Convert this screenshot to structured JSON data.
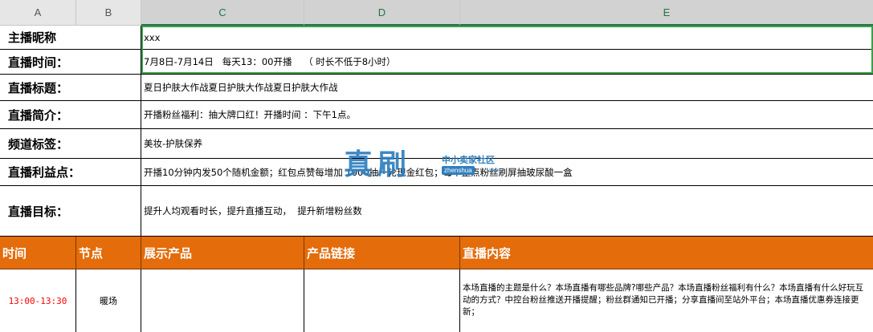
{
  "column_headers": [
    "A",
    "B",
    "C",
    "D",
    "E"
  ],
  "info_rows": [
    {
      "label": "主播昵称",
      "value": "xxx"
    },
    {
      "label": "直播时间：",
      "value": "7月8日-7月14日   每天13：00开播    （ 时长不低于8小时）"
    },
    {
      "label": "直播标题：",
      "value": "夏日护肤大作战夏日护肤大作战夏日护肤大作战"
    },
    {
      "label": "直播简介：",
      "value": "开播粉丝福利：抽大牌口红！开播时间 ：下午1点。"
    },
    {
      "label": "频道标签：",
      "value": "美妆-护肤保养"
    },
    {
      "label": "直播利益点：",
      "value": "开播10分钟内发50个随机金额；红包点赞每增加 1000抽一轮现金红包；每个整点粉丝刷屏抽玻尿酸一盒"
    },
    {
      "label": "直播目标：",
      "value": "提升人均观看时长，提升直播互动，  提升新增粉丝数"
    }
  ],
  "table_header": [
    "时间",
    "节点",
    "展示产品",
    "产品链接",
    "直播内容"
  ],
  "table_rows": [
    {
      "time": "13:00-13:30",
      "node": "暖场",
      "product": "",
      "link": "",
      "content": "本场直播的主题是什么？本场直播有哪些品牌?哪些产品？本场直播粉丝福利有什么？本场直播有什么好玩互动的方式？中控台粉丝推送开播提醒；粉丝群通知已开播；分享直播间至站外平台；本场直播优惠券连接更新；"
    }
  ],
  "watermark": {
    "big": "真刷",
    "small": "中小卖家社区",
    "domain": "zhenshua",
    "suffix": ".com"
  },
  "colors": {
    "header_orange": "#e46c0a",
    "selection_green": "#3aa04a",
    "time_red": "#ff0000",
    "watermark_blue": "#2f7fbf"
  }
}
